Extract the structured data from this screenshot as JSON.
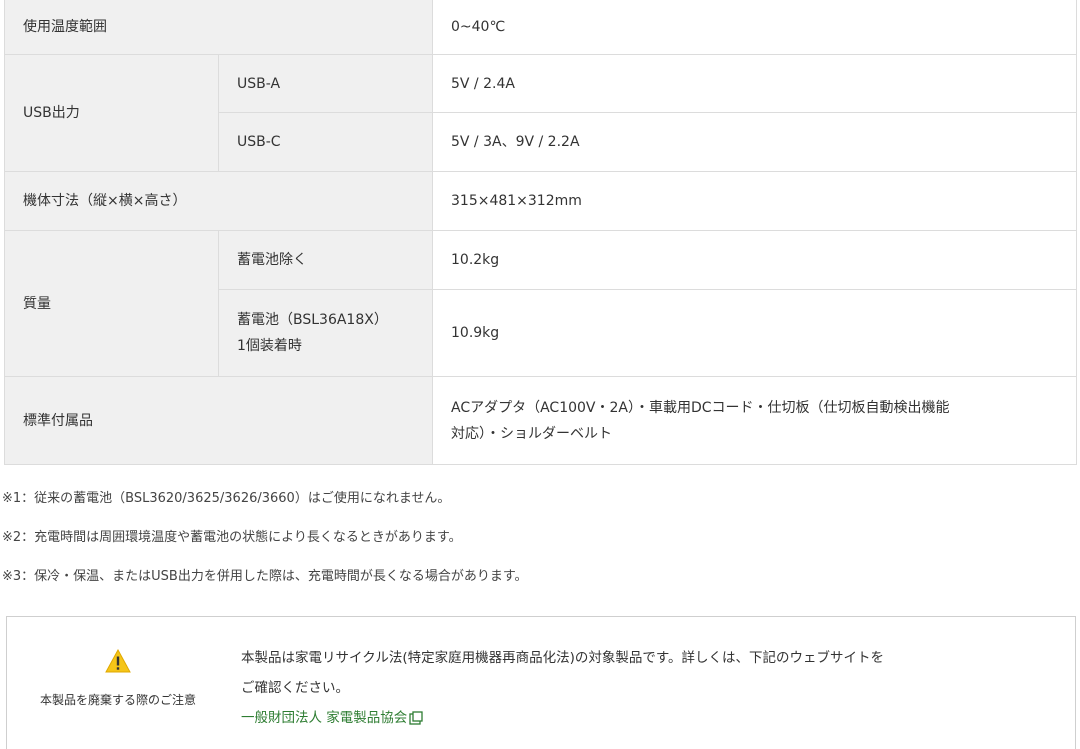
{
  "spec": {
    "operating_temp": {
      "label": "使用温度範囲",
      "value": "0~40℃"
    },
    "usb_output": {
      "label": "USB出力",
      "usb_a": {
        "label": "USB-A",
        "value": "5V / 2.4A"
      },
      "usb_c": {
        "label": "USB-C",
        "value": "5V / 3A、9V / 2.2A"
      }
    },
    "dimensions": {
      "label": "機体寸法（縦×横×高さ）",
      "value": "315×481×312mm"
    },
    "mass": {
      "label": "質量",
      "without_battery": {
        "label": "蓄電池除く",
        "value": "10.2kg"
      },
      "with_battery": {
        "label_line1": "蓄電池（BSL36A18X）",
        "label_line2": "1個装着時",
        "value": "10.9kg"
      }
    },
    "accessories": {
      "label": "標準付属品",
      "value_line1": "ACアダプタ（AC100V・2A）・車載用DCコード・仕切板（仕切板自動検出機能",
      "value_line2": "対応）・ショルダーベルト"
    }
  },
  "notes": [
    "※1：従来の蓄電池（BSL3620/3625/3626/3660）はご使用になれません。",
    "※2：充電時間は周囲環境温度や蓄電池の状態により長くなるときがあります。",
    "※3：保冷・保温、またはUSB出力を併用した際は、充電時間が長くなる場合があります。"
  ],
  "disposal": {
    "icon": "warning-icon",
    "label": "本製品を廃棄する際のご注意",
    "text_line1": "本製品は家電リサイクル法(特定家庭用機器再商品化法)の対象製品です。詳しくは、下記のウェブサイトを",
    "text_line2": "ご確認ください。",
    "link_text": "一般財団法人 家電製品協会",
    "link_icon": "external-link-icon",
    "link_color": "#2e7d32",
    "warning_color": "#f5c518"
  }
}
